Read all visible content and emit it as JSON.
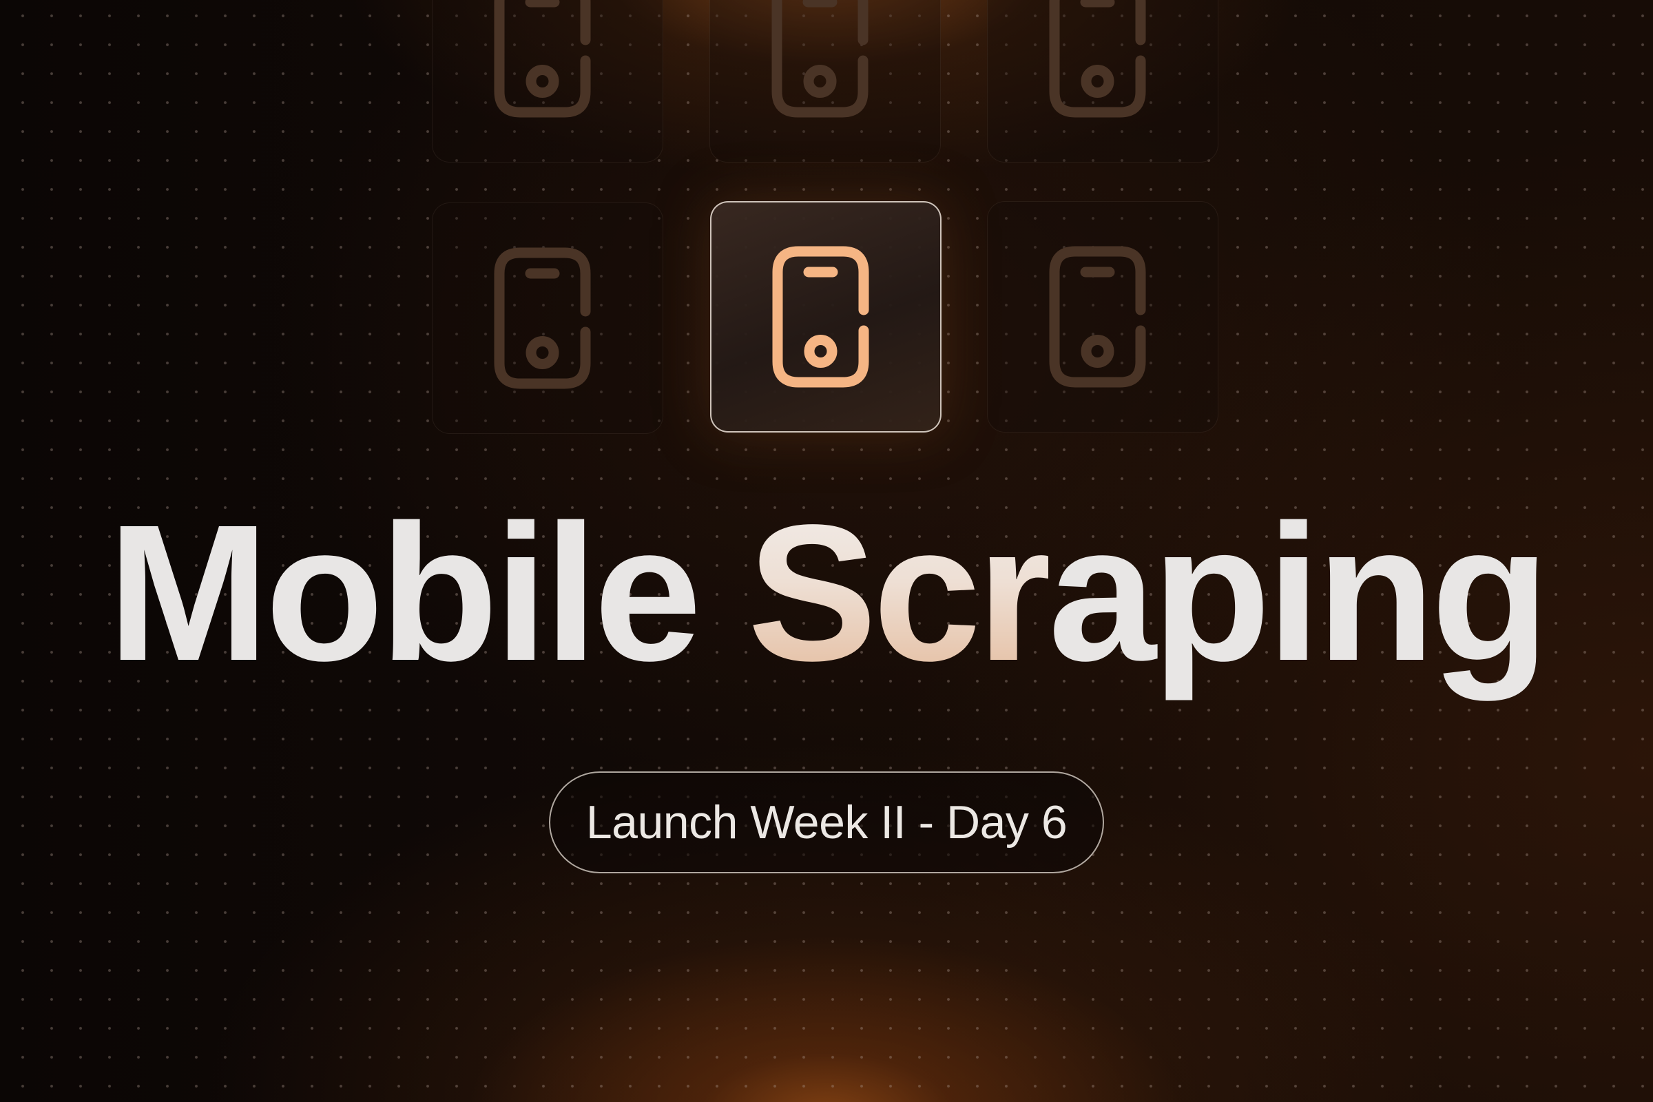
{
  "title": {
    "plain": "Mobile ",
    "highlight": "Scr",
    "rest": "aping",
    "full": "Mobile Scraping"
  },
  "badge": {
    "label": "Launch Week II - Day 6"
  },
  "tiles": [
    {
      "icon": "mobile-phone-icon",
      "state": "dim"
    },
    {
      "icon": "mobile-phone-icon",
      "state": "dim"
    },
    {
      "icon": "mobile-phone-icon",
      "state": "dim"
    },
    {
      "icon": "mobile-phone-icon",
      "state": "dim"
    },
    {
      "icon": "mobile-phone-icon",
      "state": "active"
    },
    {
      "icon": "mobile-phone-icon",
      "state": "dim"
    }
  ],
  "colors": {
    "accent": "#f5b584",
    "background": "#0d0705",
    "glow": "#8c4614",
    "title": "#e8e6e5"
  }
}
